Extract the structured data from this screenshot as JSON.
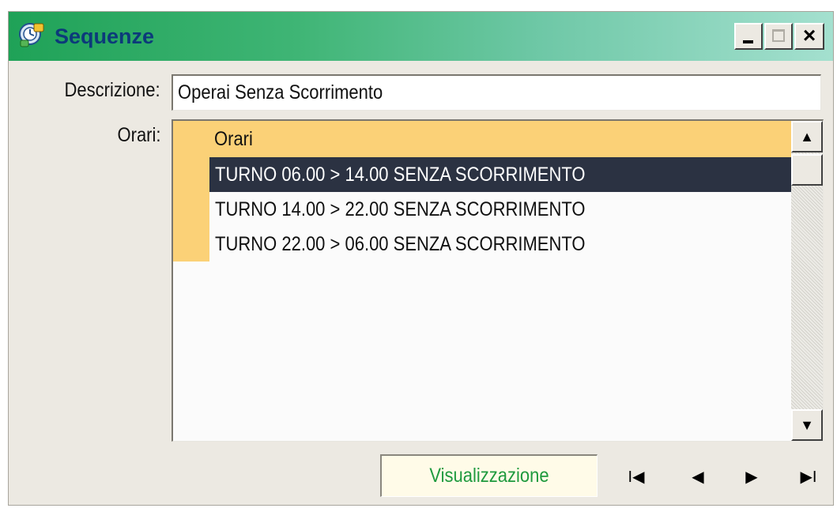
{
  "window": {
    "title": "Sequenze",
    "icon": "sequence-app-icon",
    "controls": {
      "minimize": "minimize-icon",
      "maximize": "maximize-icon",
      "close": "×"
    }
  },
  "form": {
    "descrizione_label": "Descrizione:",
    "descrizione_value": "Operai Senza Scorrimento",
    "orari_label": "Orari:"
  },
  "grid": {
    "header": "Orari",
    "rows": [
      "TURNO 06.00 > 14.00 SENZA SCORRIMENTO",
      "TURNO 14.00 > 22.00 SENZA SCORRIMENTO",
      "TURNO 22.00 > 06.00 SENZA SCORRIMENTO"
    ],
    "selected_index": 0,
    "scroll_up_glyph": "▲",
    "scroll_down_glyph": "▼"
  },
  "footer": {
    "mode": "Visualizzazione",
    "nav": {
      "first": "I◀",
      "prev": "◀",
      "next": "▶",
      "last": "▶I"
    }
  },
  "colors": {
    "title_gradient_start": "#1fa257",
    "title_gradient_end": "#a4e0cf",
    "grid_header": "#fbd177",
    "selected_row": "#2b3242",
    "mode_text": "#1f9a3e"
  }
}
